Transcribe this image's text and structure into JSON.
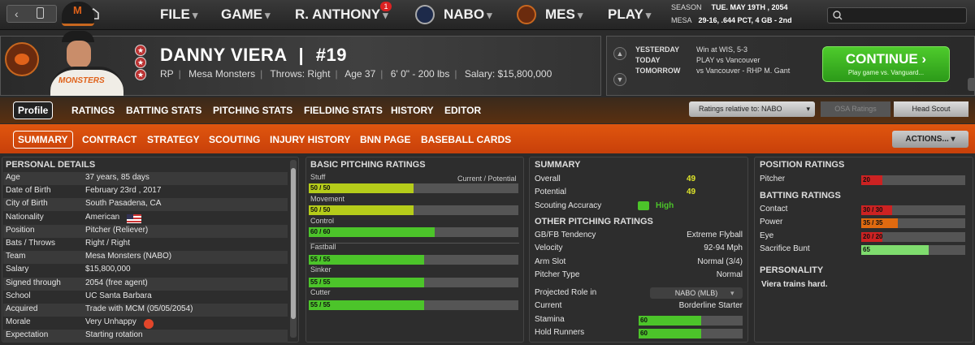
{
  "nav": {
    "back": "‹",
    "forward": "›",
    "home_icon": "home-icon"
  },
  "menu": [
    {
      "label": "FILE",
      "chev": "▾"
    },
    {
      "label": "GAME",
      "chev": "▾"
    },
    {
      "label": "R. ANTHONY",
      "chev": "▾",
      "badge": "1"
    },
    {
      "label": "NABO",
      "chev": "▾"
    },
    {
      "label": "MES",
      "chev": "▾"
    },
    {
      "label": "PLAY",
      "chev": "▾"
    }
  ],
  "season": {
    "label": "SEASON",
    "date": "TUE. MAY 19TH , 2054",
    "team": "MESA",
    "record": "29-16, .644 PCT, 4 GB - 2nd"
  },
  "player": {
    "name": "DANNY VIERA",
    "sep": "|",
    "number": "#19",
    "position": "RP",
    "team": "Mesa Monsters",
    "throws": "Throws: Right",
    "age": "Age 37",
    "size": "6' 0\" - 200 lbs",
    "salary": "Salary: $15,800,000",
    "jersey_text": "MONSTERS"
  },
  "schedule": [
    {
      "label": "YESTERDAY",
      "text": "Win at WIS, 5-3"
    },
    {
      "label": "TODAY",
      "text": "PLAY vs Vancouver"
    },
    {
      "label": "TOMORROW",
      "text": "vs Vancouver - RHP M. Gant"
    }
  ],
  "continue": {
    "label": "CONTINUE",
    "arrow": "›",
    "sub": "Play game vs. Vanguard..."
  },
  "tabs1": [
    "Profile",
    "RATINGS",
    "BATTING STATS",
    "PITCHING STATS",
    "FIELDING STATS",
    "HISTORY",
    "EDITOR"
  ],
  "ratings_relative": "Ratings relative to: NABO",
  "osa": "OSA Ratings",
  "head_scout": "Head Scout",
  "tabs2": [
    "SUMMARY",
    "CONTRACT",
    "STRATEGY",
    "SCOUTING",
    "INJURY HISTORY",
    "BNN PAGE",
    "BASEBALL CARDS"
  ],
  "actions": "ACTIONS...",
  "personal": {
    "title": "PERSONAL DETAILS",
    "rows": [
      {
        "k": "Age",
        "v": "37 years, 85 days"
      },
      {
        "k": "Date of Birth",
        "v": "February 23rd , 2017"
      },
      {
        "k": "City of Birth",
        "v": "South Pasadena, CA"
      },
      {
        "k": "Nationality",
        "v": "American"
      },
      {
        "k": "Position",
        "v": "Pitcher (Reliever)"
      },
      {
        "k": "Bats / Throws",
        "v": "Right / Right"
      },
      {
        "k": "Team",
        "v": "Mesa Monsters (NABO)"
      },
      {
        "k": "Salary",
        "v": "$15,800,000"
      },
      {
        "k": "Signed through",
        "v": "2054 (free agent)"
      },
      {
        "k": "School",
        "v": "UC Santa Barbara"
      },
      {
        "k": "Acquired",
        "v": "Trade with MCM (05/05/2054)"
      },
      {
        "k": "Morale",
        "v": "Very Unhappy"
      },
      {
        "k": "Expectation",
        "v": "Starting rotation"
      }
    ]
  },
  "pitching": {
    "title": "BASIC PITCHING RATINGS",
    "legend": "Current / Potential",
    "ratings": [
      {
        "name": "Stuff",
        "label": "50 / 50",
        "current": 50,
        "potential": 50,
        "color": "#b5cc1a"
      },
      {
        "name": "Movement",
        "label": "50 / 50",
        "current": 50,
        "potential": 50,
        "color": "#b5cc1a"
      },
      {
        "name": "Control",
        "label": "60 / 60",
        "current": 60,
        "potential": 60,
        "color": "#4cc42a"
      }
    ],
    "pitches": [
      {
        "name": "Fastball",
        "label": "55 / 55",
        "current": 55,
        "potential": 55,
        "color": "#4cc42a"
      },
      {
        "name": "Sinker",
        "label": "55 / 55",
        "current": 55,
        "potential": 55,
        "color": "#4cc42a"
      },
      {
        "name": "Cutter",
        "label": "55 / 55",
        "current": 55,
        "potential": 55,
        "color": "#4cc42a"
      }
    ]
  },
  "summary": {
    "title": "SUMMARY",
    "rows": [
      {
        "k": "Overall",
        "v": "49"
      },
      {
        "k": "Potential",
        "v": "49"
      }
    ],
    "accuracy_label": "Scouting Accuracy",
    "accuracy_value": "High",
    "other_title": "OTHER PITCHING RATINGS",
    "other": [
      {
        "k": "GB/FB Tendency",
        "v": "Extreme Flyball"
      },
      {
        "k": "Velocity",
        "v": "92-94 Mph"
      },
      {
        "k": "Arm Slot",
        "v": "Normal (3/4)"
      },
      {
        "k": "Pitcher Type",
        "v": "Normal"
      }
    ],
    "role_label": "Projected Role in",
    "role_select": "NABO (MLB)",
    "current_label": "Current",
    "current_value": "Borderline Starter",
    "bars": [
      {
        "k": "Stamina",
        "label": "60",
        "value": 60,
        "color": "#4cc42a"
      },
      {
        "k": "Hold Runners",
        "label": "60",
        "value": 60,
        "color": "#4cc42a"
      }
    ]
  },
  "position": {
    "title": "POSITION RATINGS",
    "pitcher": {
      "k": "Pitcher",
      "label": "20",
      "value": 20,
      "color": "#cc2222"
    },
    "batting_title": "BATTING RATINGS",
    "batting": [
      {
        "k": "Contact",
        "label": "30 / 30",
        "value": 30,
        "color": "#cc2222"
      },
      {
        "k": "Power",
        "label": "35 / 35",
        "value": 35,
        "color": "#e06a10"
      },
      {
        "k": "Eye",
        "label": "20 / 20",
        "value": 20,
        "color": "#cc2222"
      },
      {
        "k": "Sacrifice Bunt",
        "label": "65",
        "value": 65,
        "color": "#7fdc6e"
      }
    ],
    "personality_title": "PERSONALITY",
    "personality_text": "Viera trains hard."
  }
}
